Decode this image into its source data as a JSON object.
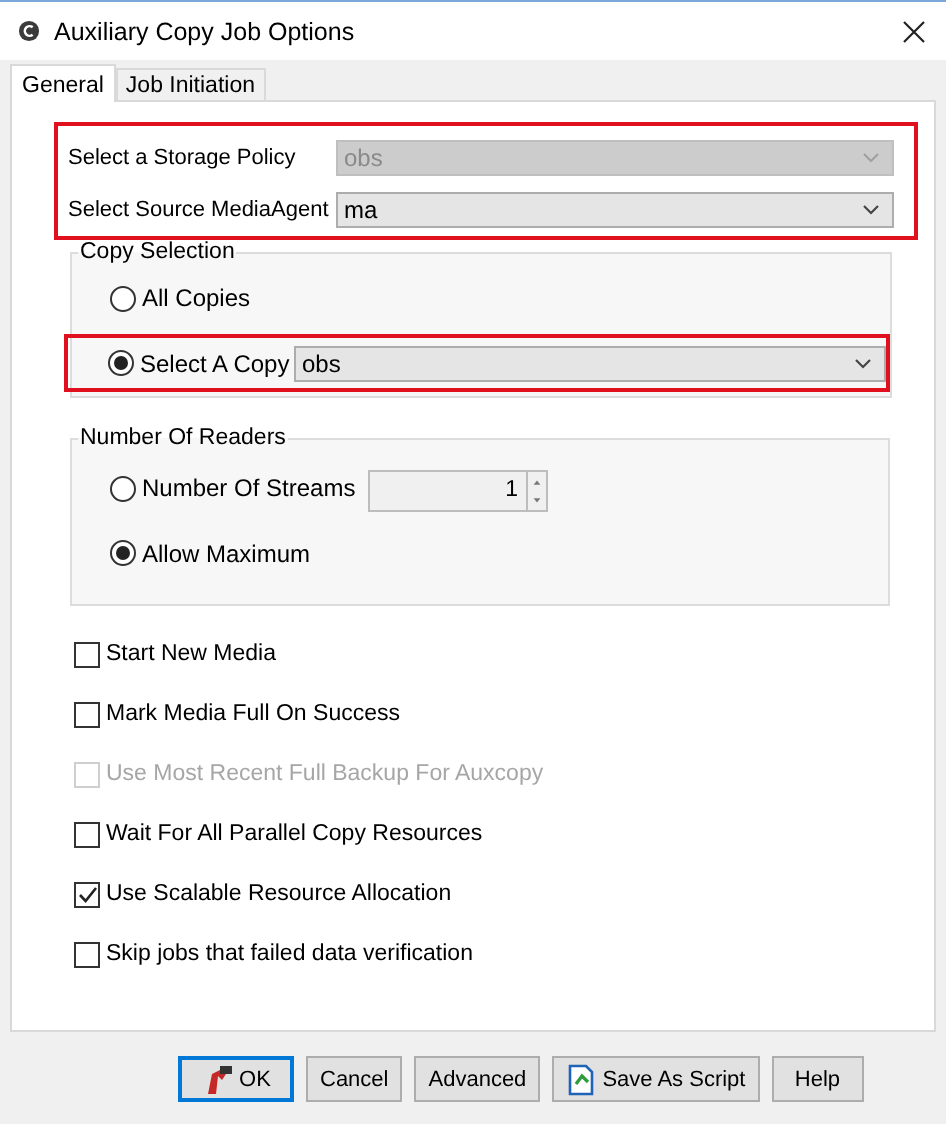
{
  "window": {
    "title": "Auxiliary Copy Job Options"
  },
  "tabs": [
    {
      "label": "General",
      "selected": true
    },
    {
      "label": "Job Initiation",
      "selected": false
    }
  ],
  "source": {
    "highlighted": true,
    "fields": [
      {
        "label": "Select a Storage Policy",
        "value": "obs",
        "disabled": true
      },
      {
        "label": "Select Source MediaAgent",
        "value": "ma",
        "disabled": false
      }
    ]
  },
  "copy_selection": {
    "title": "Copy Selection",
    "options": [
      {
        "label": "All Copies",
        "selected": false
      },
      {
        "label": "Select A Copy",
        "selected": true,
        "value": "obs",
        "highlighted": true
      }
    ]
  },
  "number_of_readers": {
    "title": "Number Of Readers",
    "options": [
      {
        "label": "Number Of Streams",
        "selected": false,
        "value": "1"
      },
      {
        "label": "Allow Maximum",
        "selected": true
      }
    ]
  },
  "options": [
    {
      "label": "Start New Media",
      "checked": false,
      "disabled": false
    },
    {
      "label": "Mark Media Full On Success",
      "checked": false,
      "disabled": false
    },
    {
      "label": "Use Most Recent Full Backup For Auxcopy",
      "checked": false,
      "disabled": true
    },
    {
      "label": "Wait For All Parallel Copy Resources",
      "checked": false,
      "disabled": false
    },
    {
      "label": "Use Scalable Resource Allocation",
      "checked": true,
      "disabled": false
    },
    {
      "label": "Skip jobs that failed data verification",
      "checked": false,
      "disabled": false
    }
  ],
  "buttons": [
    {
      "label": "OK",
      "kind": "primary"
    },
    {
      "label": "Cancel",
      "kind": "plain"
    },
    {
      "label": "Advanced",
      "kind": "plain"
    },
    {
      "label": "Save As Script",
      "kind": "script"
    },
    {
      "label": "Help",
      "kind": "plain"
    }
  ]
}
